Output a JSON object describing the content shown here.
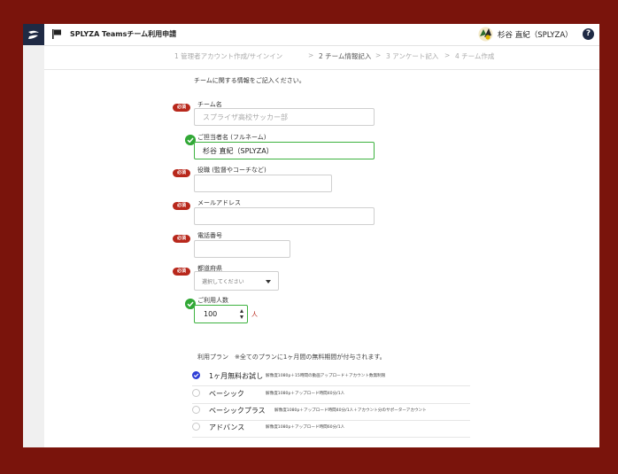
{
  "header": {
    "app_title": "SPLYZA Teamsチーム利用申請",
    "user_name": "杉谷 直紀（SPLYZA）",
    "help_label": "?"
  },
  "steps": [
    {
      "label": "1 管理者アカウント作成/サインイン",
      "active": false
    },
    {
      "label": "2 チーム情報記入",
      "active": true
    },
    {
      "label": "3 アンケート記入",
      "active": false
    },
    {
      "label": "4 チーム作成",
      "active": false
    }
  ],
  "step_separator": ">",
  "intro_text": "チームに関する情報をご記入ください。",
  "required_badge": "必須",
  "form": {
    "team_name": {
      "label": "チーム名",
      "value": "",
      "placeholder": "スプライザ高校サッカー部"
    },
    "person_name": {
      "label": "ご担当者名 (フルネーム)",
      "value": "杉谷 直紀（SPLYZA）"
    },
    "position": {
      "label": "役職 (監督やコーチなど)",
      "value": ""
    },
    "email": {
      "label": "メールアドレス",
      "value": ""
    },
    "phone": {
      "label": "電話番号",
      "value": ""
    },
    "prefecture": {
      "label": "都道府県",
      "selected": "選択してください"
    },
    "user_count": {
      "label": "ご利用人数",
      "value": "100",
      "unit": "人"
    }
  },
  "plans": {
    "heading": "利用プラン　※全てのプランに1ヶ月間の無料期間が付与されます。",
    "items": [
      {
        "name": "1ヶ月無料お試し",
        "desc": "解像度1080p＋15時間の動画アップロード＋アカウント数無制限",
        "checked": true
      },
      {
        "name": "ベーシック",
        "desc": "解像度1080p＋アップロード時間40分/1人",
        "checked": false
      },
      {
        "name": "ベーシックプラス",
        "desc": "解像度1080p＋アップロード時間40分/1人＋アカウント分のサポーターアカウント",
        "checked": false
      },
      {
        "name": "アドバンス",
        "desc": "解像度1080p＋アップロード時間60分/1人",
        "checked": false
      }
    ]
  },
  "colors": {
    "frame": "#7a140c",
    "required": "#b8281c",
    "valid": "#3db23f",
    "radio_checked": "#2f3fd6",
    "logo_bg": "#1f2a44"
  }
}
